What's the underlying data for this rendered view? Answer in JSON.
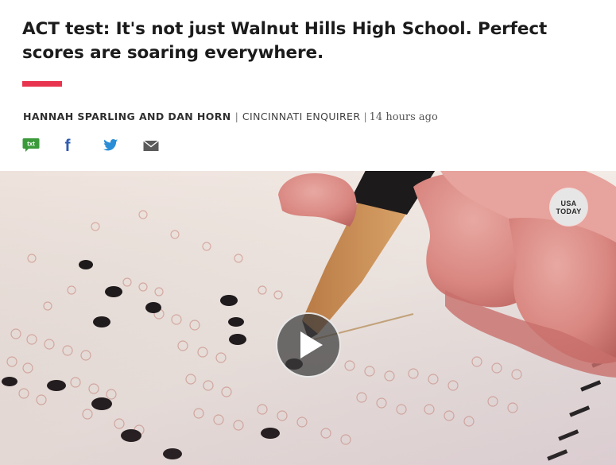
{
  "article": {
    "headline": "ACT test: It's not just Walnut Hills High School. Perfect scores are soaring everywhere.",
    "accent_color": "#e8344e"
  },
  "byline": {
    "authors": "HANNAH SPARLING AND DAN HORN",
    "separator": "|",
    "outlet": "CINCINNATI ENQUIRER",
    "separator2": "|",
    "timestamp": "14 hours ago"
  },
  "share": {
    "items": [
      {
        "icon": "txt-message-icon",
        "label": "txt",
        "color": "#3a9a3a"
      },
      {
        "icon": "facebook-icon",
        "label": "f",
        "color": "#2d5bb0"
      },
      {
        "icon": "twitter-icon",
        "color": "#2a8ed6"
      },
      {
        "icon": "email-icon",
        "color": "#5a5a5a"
      }
    ]
  },
  "video": {
    "badge_line1": "USA",
    "badge_line2": "TODAY",
    "play_icon": "play-icon"
  }
}
